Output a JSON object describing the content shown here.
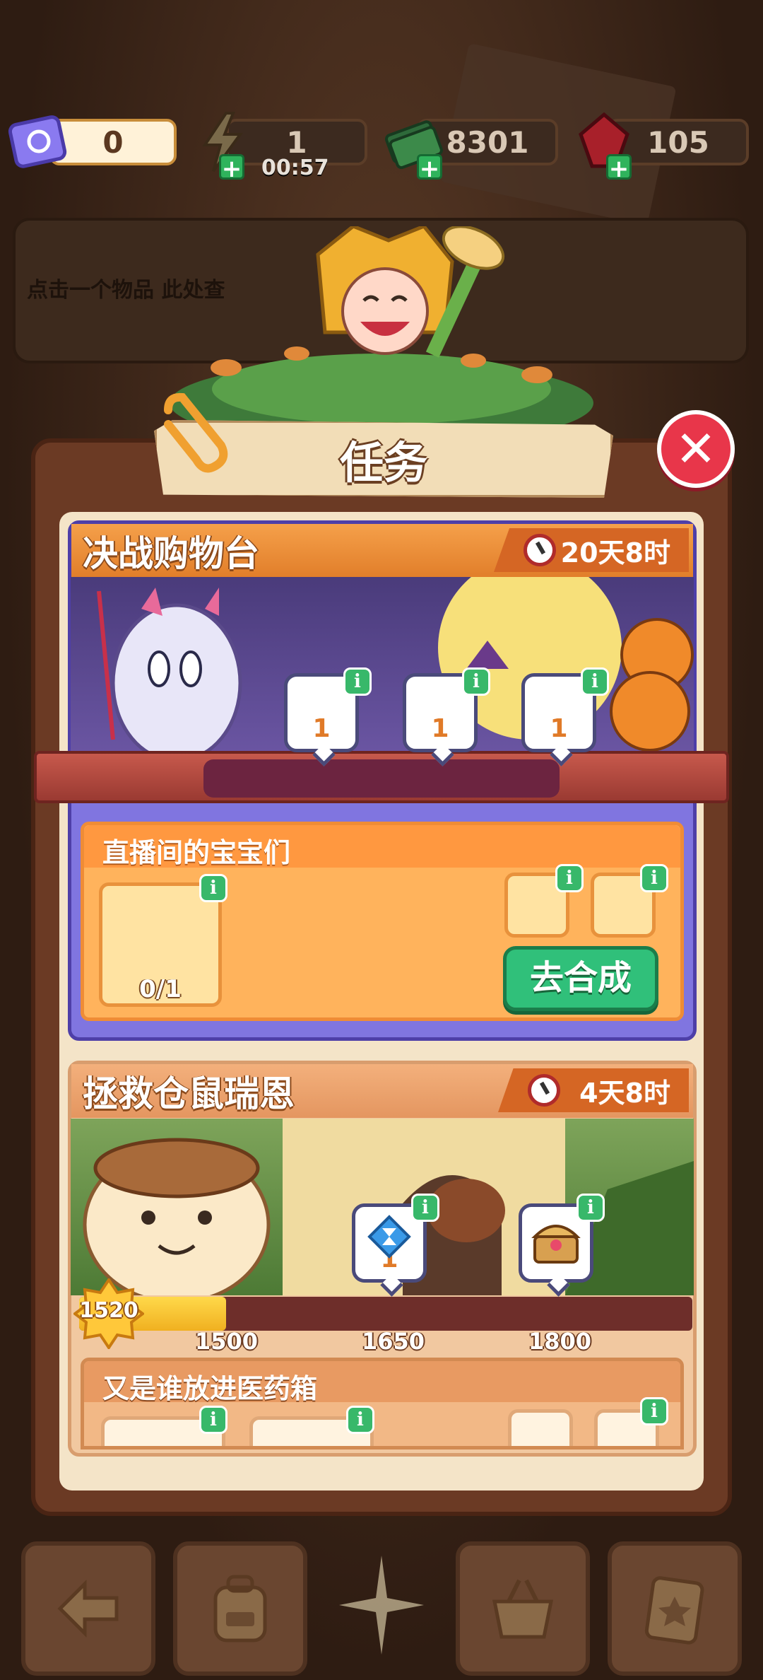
{
  "resources": {
    "ticket": "0",
    "energy": "1",
    "energy_timer": "00:57",
    "cash": "8301",
    "gems": "105"
  },
  "info_panel": {
    "hint": "点击一个物品   此处查"
  },
  "modal": {
    "title": "任务",
    "close_label": "✕"
  },
  "event1": {
    "title": "决战购物台",
    "time_left": "20天8时",
    "rewards": [
      "1",
      "1",
      "1"
    ],
    "task": {
      "title": "直播间的宝宝们",
      "progress": "0/1",
      "button": "去合成"
    }
  },
  "event2": {
    "title": "拯救仓鼠瑞恩",
    "time_left": "4天8时",
    "level": "1520",
    "progress_ticks": [
      "1500",
      "1650",
      "1800"
    ],
    "progress_fraction": 0.09,
    "reward_count": "1",
    "task": {
      "title": "又是谁放进医药箱"
    }
  },
  "info_badge": "i",
  "icons": {
    "ticket": "ticket-icon",
    "energy": "lightning-icon",
    "cash": "cash-stack-icon",
    "gems": "ruby-icon",
    "back": "arrow-left-icon",
    "bag": "backpack-icon",
    "basket": "basket-icon",
    "tasks": "clipboard-star-icon"
  },
  "colors": {
    "accent_green": "#30c07a",
    "close_red": "#e8364a",
    "event1_frame": "#8075e0",
    "event_header": "#f5a04a"
  }
}
